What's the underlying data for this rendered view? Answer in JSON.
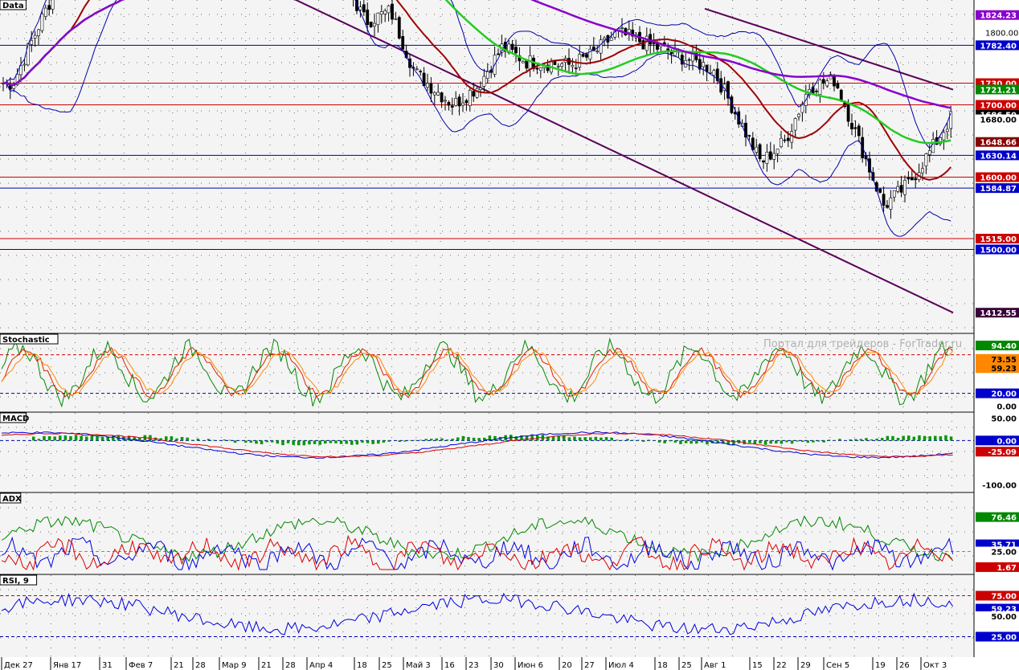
{
  "colors": {
    "candle_up": "#ffffff",
    "candle_down": "#000000",
    "bollinger": "#0000aa",
    "ma_red": "#a00000",
    "ma_green": "#22cc22",
    "ma_purple": "#8800cc",
    "trend_down": "#5a005a",
    "hline_red": "#cc0000",
    "hline_blue": "#0000aa",
    "stoch_green": "#008800",
    "stoch_red": "#dd2200",
    "stoch_orange": "#ff8800",
    "macd_blue": "#0000dd",
    "macd_red": "#dd0000",
    "macd_hist": "#009900",
    "adx_green": "#008800",
    "adx_blue": "#0000dd",
    "adx_red": "#dd0000",
    "rsi_blue": "#0000dd"
  },
  "panels": {
    "price": {
      "title": "Data"
    },
    "stoch": {
      "title": "Stochastic"
    },
    "macd": {
      "title": "MACD"
    },
    "adx": {
      "title": "ADX"
    },
    "rsi": {
      "title": "RSI, 9"
    }
  },
  "watermark": "Портал для трейдеров - ForTrader.ru",
  "chart_data": [
    {
      "type": "candlestick",
      "panel": "price",
      "y_ticks": [
        1800.0
      ],
      "price_tags": [
        {
          "text": "1824.23",
          "price": 1824.23,
          "kind": "purple"
        },
        {
          "text": "1782.40",
          "price": 1782.4,
          "kind": "blue"
        },
        {
          "text": "1730.00",
          "price": 1730.0,
          "kind": "red"
        },
        {
          "text": "1721.21",
          "price": 1721.21,
          "kind": "green"
        },
        {
          "text": "1700.00",
          "price": 1700.0,
          "kind": "red"
        },
        {
          "text": "1686.50",
          "price": 1686.5,
          "kind": "last"
        },
        {
          "text": "1680.00",
          "price": 1680.0,
          "kind": "plain"
        },
        {
          "text": "1648.66",
          "price": 1648.66,
          "kind": "darkred"
        },
        {
          "text": "1630.14",
          "price": 1630.14,
          "kind": "blue"
        },
        {
          "text": "1600.00",
          "price": 1600.0,
          "kind": "red"
        },
        {
          "text": "1584.87",
          "price": 1584.87,
          "kind": "blue"
        },
        {
          "text": "1515.00",
          "price": 1515.0,
          "kind": "red"
        },
        {
          "text": "1500.00",
          "price": 1500.0,
          "kind": "blue"
        },
        {
          "text": "1412.55",
          "price": 1412.55,
          "kind": "trend"
        }
      ],
      "levels_red": [
        1730.0,
        1700.0,
        1600.0,
        1515.0
      ],
      "levels_blue": [
        1782.4,
        1630.14,
        1584.87,
        1500.0
      ],
      "trendlines": [
        {
          "from": [
            "Дек 27",
            1905
          ],
          "to": [
            "Окт 3+",
            1412.55
          ],
          "color": "trend"
        },
        {
          "from": [
            "Авг 1",
            1833
          ],
          "to": [
            "Окт 3+",
            1721
          ],
          "color": "trend"
        }
      ],
      "series_points": {
        "close": [
          [
            "Дек 27",
            1730
          ],
          [
            "Янв 17",
            1880
          ],
          [
            "31",
            1910
          ],
          [
            "Фев 7",
            1950
          ],
          [
            "Апр 4",
            1940
          ],
          [
            "Май 3",
            1745
          ],
          [
            "16",
            1700
          ],
          [
            "23",
            1725
          ],
          [
            "30",
            1780
          ],
          [
            "Июн 6",
            1760
          ],
          [
            "20",
            1755
          ],
          [
            "27",
            1770
          ],
          [
            "Июл 4",
            1800
          ],
          [
            "18",
            1815
          ],
          [
            "25",
            1830
          ],
          [
            "Авг 1",
            1750
          ],
          [
            "15",
            1620
          ],
          [
            "22",
            1650
          ],
          [
            "29",
            1725
          ],
          [
            "Сен 5",
            1735
          ],
          [
            "19",
            1560
          ],
          [
            "26",
            1590
          ],
          [
            "Окт 3",
            1640
          ],
          [
            "Окт 3+",
            1686.5
          ]
        ]
      }
    },
    {
      "type": "line",
      "panel": "stoch",
      "y_ticks": [
        0.0,
        20.0
      ],
      "tags": [
        {
          "text": "94.40",
          "value": 94.4,
          "kind": "green"
        },
        {
          "text": "73.55",
          "value": 73.55,
          "kind": "orange"
        },
        {
          "text": "59.23",
          "value": 59.23,
          "kind": "orange"
        },
        {
          "text": "20.00",
          "value": 20.0,
          "kind": "blue"
        },
        {
          "text": "0.00",
          "value": 0.0,
          "kind": "plain"
        }
      ]
    },
    {
      "type": "line",
      "panel": "macd",
      "y_ticks": [
        50.0,
        0.0,
        -100.0
      ],
      "tags": [
        {
          "text": "50.00",
          "value": 50.0,
          "kind": "plain"
        },
        {
          "text": "0.00",
          "value": 0.0,
          "kind": "blue"
        },
        {
          "text": "-25.09",
          "value": -25.09,
          "kind": "red"
        },
        {
          "text": "-100.00",
          "value": -100.0,
          "kind": "plain"
        }
      ]
    },
    {
      "type": "line",
      "panel": "adx",
      "y_ticks": [
        25.0
      ],
      "tags": [
        {
          "text": "76.46",
          "value": 76.46,
          "kind": "green"
        },
        {
          "text": "35.71",
          "value": 35.71,
          "kind": "blue"
        },
        {
          "text": "25.00",
          "value": 25.0,
          "kind": "plain"
        },
        {
          "text": "1.67",
          "value": 1.67,
          "kind": "red"
        }
      ]
    },
    {
      "type": "line",
      "panel": "rsi",
      "y_ticks": [
        50.0
      ],
      "tags": [
        {
          "text": "75.00",
          "value": 75.0,
          "kind": "red"
        },
        {
          "text": "59.23",
          "value": 59.23,
          "kind": "blue"
        },
        {
          "text": "50.00",
          "value": 50.0,
          "kind": "plain"
        },
        {
          "text": "25.00",
          "value": 25.0,
          "kind": "blue"
        }
      ]
    }
  ],
  "x_axis": {
    "labels": [
      "Дек 27",
      "Янв 17",
      "31",
      "Фев 7",
      "21",
      "28",
      "Мар 9",
      "21",
      "28",
      "Апр 4",
      "18",
      "25",
      "Май 3",
      "16",
      "23",
      "30",
      "Июн 6",
      "20",
      "27",
      "Июл 4",
      "18",
      "25",
      "Авг 1",
      "15",
      "22",
      "29",
      "Сен 5",
      "19",
      "26",
      "Окт 3"
    ]
  }
}
